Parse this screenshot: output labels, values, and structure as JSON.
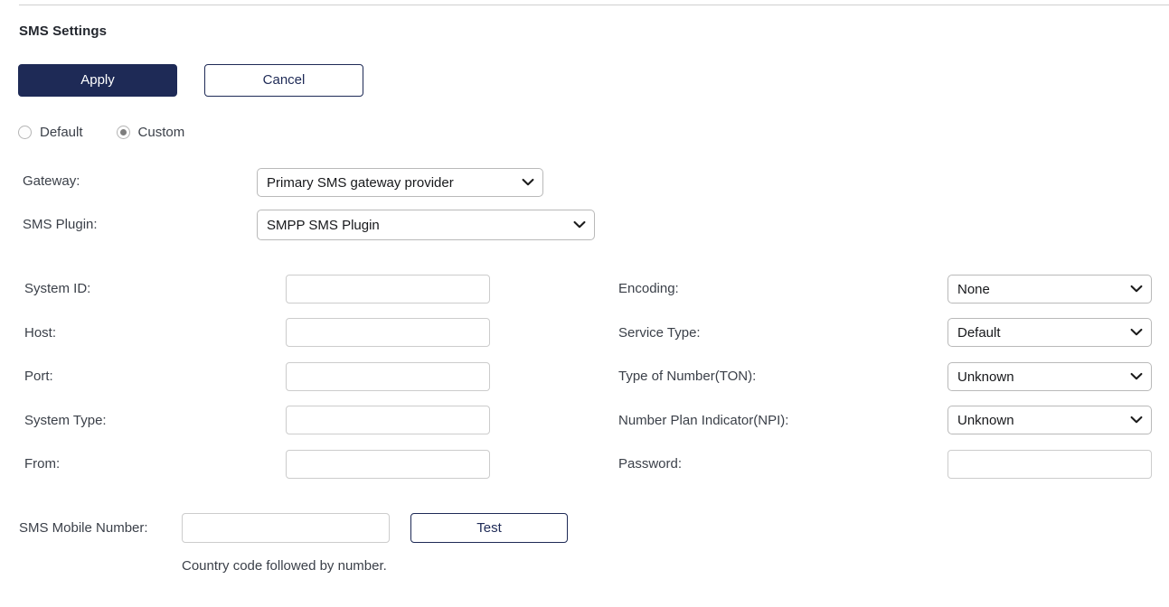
{
  "page": {
    "title": "SMS Settings"
  },
  "toolbar": {
    "apply_label": "Apply",
    "cancel_label": "Cancel"
  },
  "mode": {
    "options": [
      {
        "label": "Default",
        "checked": false
      },
      {
        "label": "Custom",
        "checked": true
      }
    ]
  },
  "top_fields": [
    {
      "label": "Gateway:",
      "type": "select",
      "value": "Primary SMS gateway provider"
    },
    {
      "label": "SMS Plugin:",
      "type": "select",
      "value": "SMPP SMS Plugin"
    }
  ],
  "left_fields": [
    {
      "label": "System ID:",
      "type": "text",
      "value": ""
    },
    {
      "label": "Host:",
      "type": "text",
      "value": ""
    },
    {
      "label": "Port:",
      "type": "text",
      "value": ""
    },
    {
      "label": "System Type:",
      "type": "text",
      "value": ""
    },
    {
      "label": "From:",
      "type": "text",
      "value": ""
    }
  ],
  "right_fields": [
    {
      "label": "Encoding:",
      "type": "select",
      "value": "None"
    },
    {
      "label": "Service Type:",
      "type": "select",
      "value": "Default"
    },
    {
      "label": "Type of Number(TON):",
      "type": "select",
      "value": "Unknown"
    },
    {
      "label": "Number Plan Indicator(NPI):",
      "type": "select",
      "value": "Unknown"
    },
    {
      "label": "Password:",
      "type": "password",
      "value": ""
    }
  ],
  "test_row": {
    "label": "SMS Mobile Number:",
    "value": "",
    "button_label": "Test",
    "hint": "Country code followed by number."
  },
  "icons": {
    "chevron": "chevron-down-icon"
  },
  "colors": {
    "accent": "#1e2a56",
    "border": "#cccccc",
    "text": "#3b4049",
    "divider": "#cfcfcf"
  }
}
